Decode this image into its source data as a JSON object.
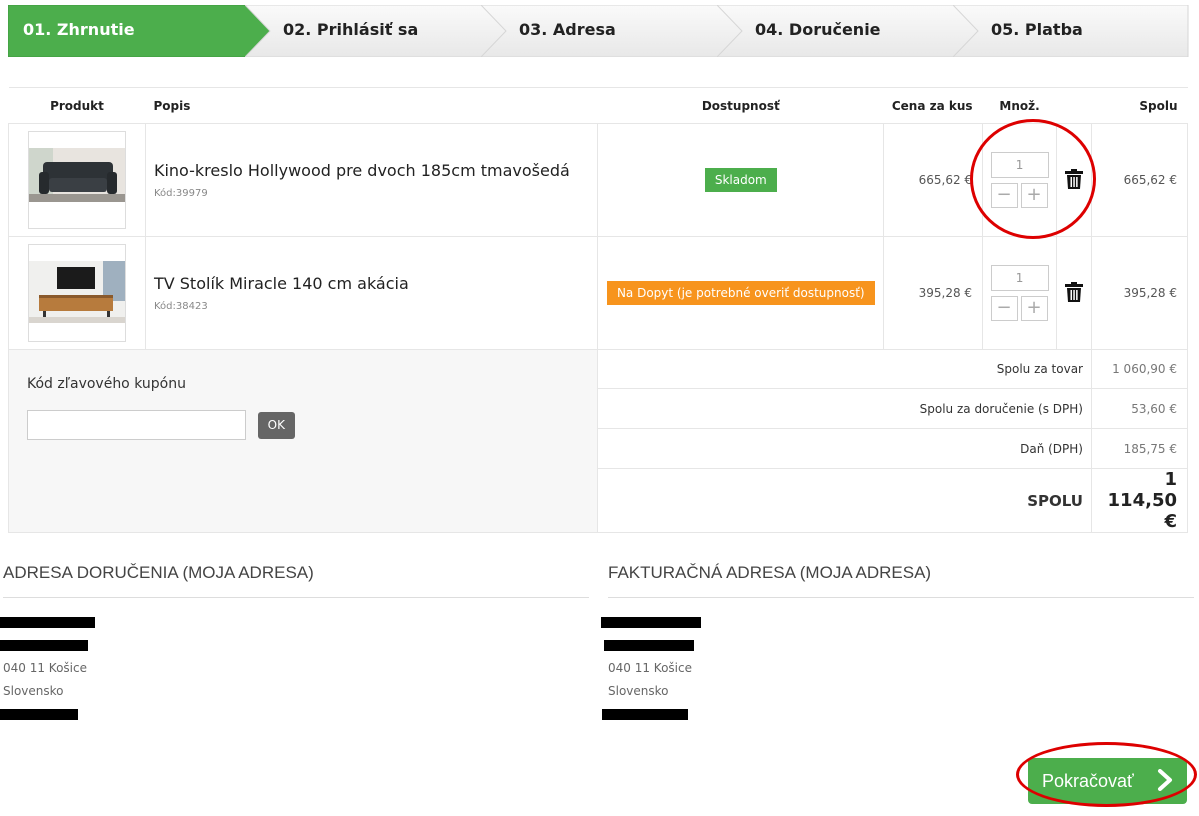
{
  "steps": [
    {
      "label": "01. Zhrnutie",
      "active": true
    },
    {
      "label": "02. Prihlásiť sa",
      "active": false
    },
    {
      "label": "03. Adresa",
      "active": false
    },
    {
      "label": "04. Doručenie",
      "active": false
    },
    {
      "label": "05. Platba",
      "active": false
    }
  ],
  "cart": {
    "headers": {
      "product": "Produkt",
      "description": "Popis",
      "availability": "Dostupnosť",
      "unit_price": "Cena za kus",
      "quantity": "Množ.",
      "total": "Spolu"
    },
    "items": [
      {
        "name": "Kino-kreslo Hollywood pre dvoch 185cm tmavošedá",
        "code": "Kód:39979",
        "availability": "Skladom",
        "availability_color": "#4cae4c",
        "unit_price": "665,62 €",
        "quantity": "1",
        "total": "665,62 €"
      },
      {
        "name": "TV Stolík Miracle 140 cm akácia",
        "code": "Kód:38423",
        "availability": "Na Dopyt (je potrebné overiť dostupnosť)",
        "availability_color": "#f7941d",
        "unit_price": "395,28 €",
        "quantity": "1",
        "total": "395,28 €"
      }
    ],
    "coupon": {
      "label": "Kód zľavového kupónu",
      "placeholder": "",
      "button": "OK"
    },
    "totals": [
      {
        "label": "Spolu za tovar",
        "value": "1 060,90 €"
      },
      {
        "label": "Spolu za doručenie (s DPH)",
        "value": "53,60 €"
      },
      {
        "label": "Daň (DPH)",
        "value": "185,75 €"
      }
    ],
    "grand_total": {
      "label": "SPOLU",
      "value": "1 114,50 €"
    }
  },
  "addresses": {
    "delivery": {
      "title": "ADRESA DORUČENIA (MOJA ADRESA)",
      "city": "040 11 Košice",
      "country": "Slovensko"
    },
    "billing": {
      "title": "FAKTURAČNÁ ADRESA (MOJA ADRESA)",
      "city": "040 11 Košice",
      "country": "Slovensko"
    }
  },
  "continue_button": {
    "label": "Pokračovať"
  },
  "colors": {
    "accent_green": "#4cae4c",
    "warning_orange": "#f7941d",
    "annotation_red": "#dd0000"
  }
}
